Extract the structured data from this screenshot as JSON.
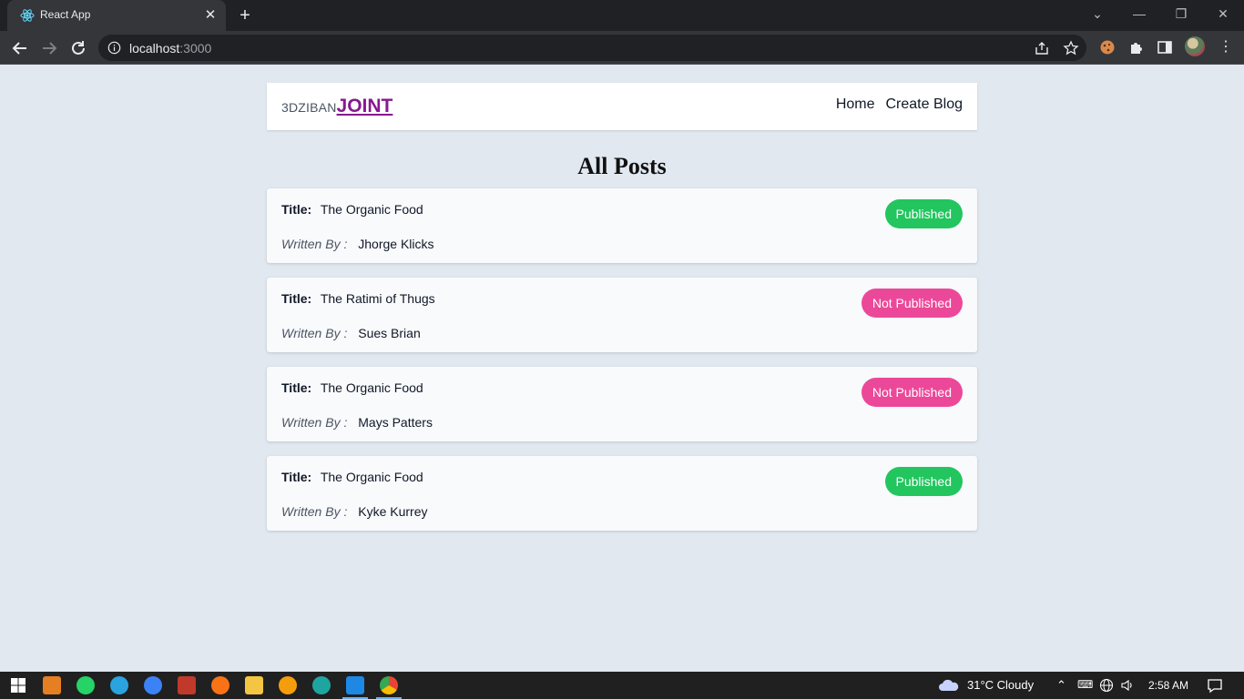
{
  "browser": {
    "tab_title": "React App",
    "url_host": "localhost",
    "url_port": ":3000"
  },
  "site": {
    "logo_small": "3DZIBAN",
    "logo_big": "JOINT",
    "nav": [
      "Home",
      "Create Blog"
    ],
    "heading": "All Posts"
  },
  "labels": {
    "title": "Title:",
    "written_by": "Written By :"
  },
  "posts": [
    {
      "title": "The Organic Food",
      "author": "Jhorge Klicks",
      "status": "Published"
    },
    {
      "title": "The Ratimi of Thugs",
      "author": "Sues Brian",
      "status": "Not Published"
    },
    {
      "title": "The Organic Food",
      "author": "Mays Patters",
      "status": "Not Published"
    },
    {
      "title": "The Organic Food",
      "author": "Kyke Kurrey",
      "status": "Published"
    }
  ],
  "colors": {
    "published": "#22c55e",
    "not_published": "#ec4899",
    "brand": "#86198f",
    "page_bg": "#e2e8f0"
  },
  "taskbar": {
    "weather": "31°C  Cloudy",
    "time": "2:58 AM"
  }
}
